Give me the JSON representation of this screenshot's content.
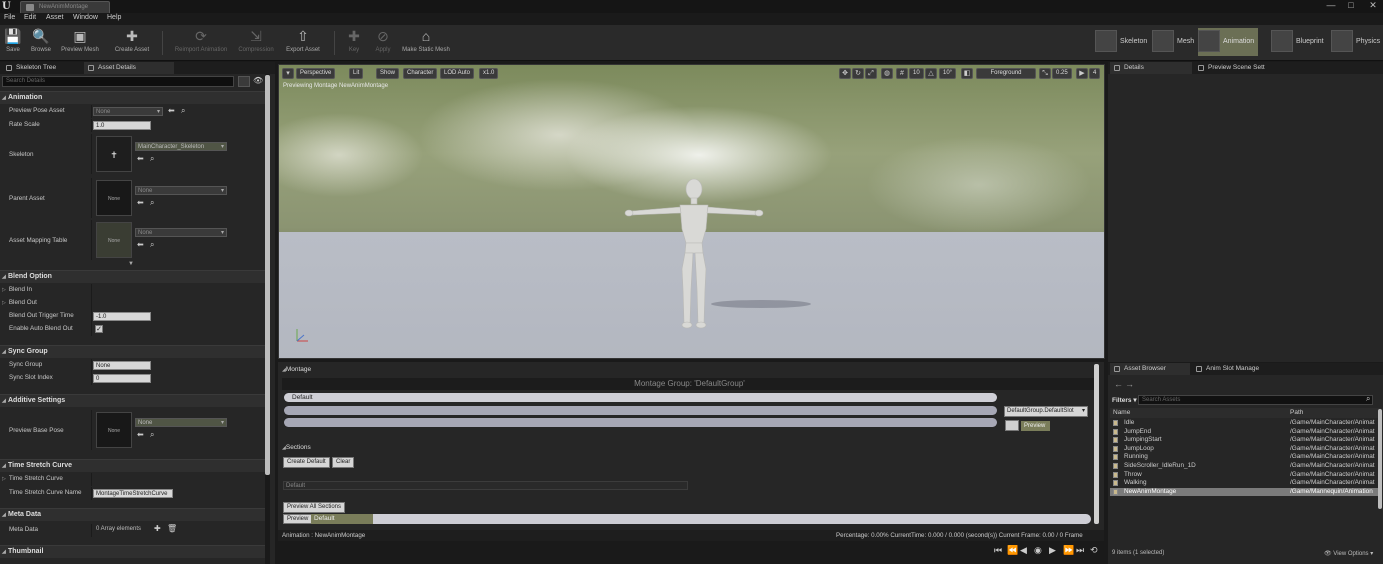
{
  "window": {
    "tab_title": "NewAnimMontage",
    "controls": [
      "—",
      "□",
      "✕"
    ]
  },
  "menu": [
    "File",
    "Edit",
    "Asset",
    "Window",
    "Help"
  ],
  "toolbar": {
    "buttons": [
      {
        "label": "Save",
        "icon": "save-icon",
        "glyph": "💾",
        "dim": false
      },
      {
        "label": "Browse",
        "icon": "browse-icon",
        "glyph": "🔍",
        "dim": false
      },
      {
        "label": "Preview Mesh",
        "icon": "preview-mesh-icon",
        "glyph": "▣",
        "dim": false
      },
      {
        "label": "Create Asset",
        "icon": "create-asset-icon",
        "glyph": "✚",
        "dim": false
      },
      {
        "label": "Reimport Animation",
        "icon": "reimport-icon",
        "glyph": "⟳",
        "dim": true
      },
      {
        "label": "Compression",
        "icon": "compression-icon",
        "glyph": "⇲",
        "dim": true
      },
      {
        "label": "Export Asset",
        "icon": "export-asset-icon",
        "glyph": "⇧",
        "dim": false
      },
      {
        "label": "Key",
        "icon": "key-icon",
        "glyph": "✚",
        "dim": true
      },
      {
        "label": "Apply",
        "icon": "apply-icon",
        "glyph": "⊘",
        "dim": true
      },
      {
        "label": "Make Static Mesh",
        "icon": "make-static-mesh-icon",
        "glyph": "⌂",
        "dim": false
      }
    ],
    "modes": [
      {
        "label": "Skeleton",
        "active": false
      },
      {
        "label": "Mesh",
        "active": false
      },
      {
        "label": "Animation",
        "active": true
      },
      {
        "label": "Blueprint",
        "active": false
      },
      {
        "label": "Physics",
        "active": false
      }
    ]
  },
  "left_panel": {
    "tabs": [
      "Skeleton Tree",
      "Asset Details"
    ],
    "search_placeholder": "Search Details",
    "sections": {
      "animation": "Animation",
      "blend_option": "Blend Option",
      "sync_group": "Sync Group",
      "additive": "Additive Settings",
      "time_stretch": "Time Stretch Curve",
      "meta_data": "Meta Data",
      "thumbnail": "Thumbnail"
    },
    "props": {
      "preview_pose_asset": {
        "label": "Preview Pose Asset",
        "value": "None"
      },
      "rate_scale": {
        "label": "Rate Scale",
        "value": "1.0"
      },
      "skeleton": {
        "label": "Skeleton",
        "value": "MainCharacter_Skeleton"
      },
      "parent_asset": {
        "label": "Parent Asset",
        "value": "None",
        "thumb": "None"
      },
      "asset_mapping_table": {
        "label": "Asset Mapping Table",
        "value": "None",
        "thumb": "None"
      },
      "blend_in": {
        "label": "Blend In"
      },
      "blend_out": {
        "label": "Blend Out"
      },
      "blend_out_trigger_time": {
        "label": "Blend Out Trigger Time",
        "value": "-1.0"
      },
      "enable_auto_blend_out": {
        "label": "Enable Auto Blend Out",
        "checked": true
      },
      "sync_group": {
        "label": "Sync Group",
        "value": "None"
      },
      "sync_slot_index": {
        "label": "Sync Slot Index",
        "value": "0"
      },
      "preview_base_pose": {
        "label": "Preview Base Pose",
        "value": "None",
        "thumb": "None"
      },
      "time_stretch_curve": {
        "label": "Time Stretch Curve"
      },
      "time_stretch_curve_name": {
        "label": "Time Stretch Curve Name",
        "value": "MontageTimeStretchCurve"
      },
      "meta_data": {
        "label": "Meta Data",
        "value": "0 Array elements"
      }
    }
  },
  "viewport": {
    "toolbar_left": [
      "Perspective",
      "Lit",
      "Show",
      "Character",
      "LOD Auto",
      "x1.0"
    ],
    "grid_snap": "10",
    "rot_snap": "10°",
    "foreground": "Foreground",
    "scale_snap": "0.25",
    "cam_speed": "4",
    "preview_text": "Previewing Montage NewAnimMontage"
  },
  "montage": {
    "section_title": "Montage",
    "group_label": "Montage Group: 'DefaultGroup'",
    "slot_label": "Default",
    "slot_select": "DefaultGroup.DefaultSlot",
    "preview_button": "Preview",
    "sections_title": "Sections",
    "create_default": "Create Default",
    "clear": "Clear",
    "default_field": "Default",
    "preview_all_sections": "Preview All Sections",
    "preview_row_btn": "Preview",
    "preview_row_section": "Default"
  },
  "status": {
    "animation": "Animation : NewAnimMontage",
    "percentage": "Percentage: 0.00% CurrentTime: 0.000 / 0.000 (second(s)) Current Frame: 0.00 / 0 Frame"
  },
  "right_panel": {
    "top_tabs": [
      "Details",
      "Preview Scene Sett"
    ],
    "bottom_tabs": [
      "Asset Browser",
      "Anim Slot Manage"
    ],
    "filters": "Filters",
    "search_placeholder": "Search Assets",
    "columns": [
      "Name",
      "Path"
    ],
    "assets": [
      {
        "name": "Idle",
        "path": "/Game/MainCharacter/Animat",
        "selected": false
      },
      {
        "name": "JumpEnd",
        "path": "/Game/MainCharacter/Animat",
        "selected": false
      },
      {
        "name": "JumpingStart",
        "path": "/Game/MainCharacter/Animat",
        "selected": false
      },
      {
        "name": "JumpLoop",
        "path": "/Game/MainCharacter/Animat",
        "selected": false
      },
      {
        "name": "Running",
        "path": "/Game/MainCharacter/Animat",
        "selected": false
      },
      {
        "name": "SideScroller_IdleRun_1D",
        "path": "/Game/MainCharacter/Animat",
        "selected": false
      },
      {
        "name": "Throw",
        "path": "/Game/MainCharacter/Animat",
        "selected": false
      },
      {
        "name": "Walking",
        "path": "/Game/MainCharacter/Animat",
        "selected": false
      },
      {
        "name": "NewAnimMontage",
        "path": "/Game/Mannequin/Animation",
        "selected": true
      }
    ],
    "items_count": "9 items (1 selected)",
    "view_options": "View Options"
  }
}
